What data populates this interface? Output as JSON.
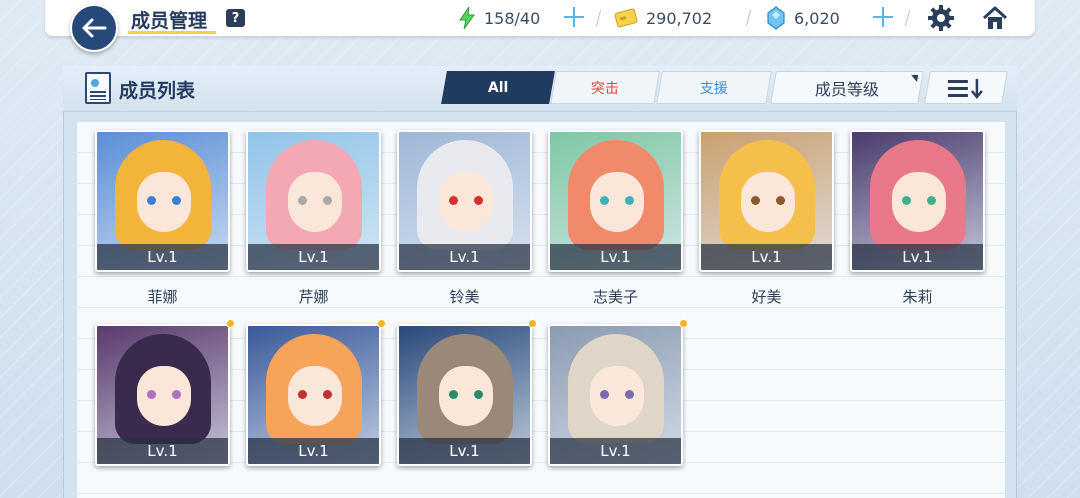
{
  "header": {
    "title": "成员管理",
    "help": "?",
    "ap": "158/40",
    "credits": "290,702",
    "gems": "6,020"
  },
  "panel": {
    "title": "成员列表",
    "tabs": [
      "All",
      "突击",
      "支援"
    ],
    "sort_label": "成员等级"
  },
  "members": [
    {
      "name": "菲娜",
      "level": "Lv.1",
      "new": false,
      "hair": "#f3b43a",
      "bg": "#5a8fd6",
      "eye": "#3a7fd4"
    },
    {
      "name": "芹娜",
      "level": "Lv.1",
      "new": false,
      "hair": "#f3a8b4",
      "bg": "#8fc4e8",
      "eye": "#a9a9a9"
    },
    {
      "name": "铃美",
      "level": "Lv.1",
      "new": false,
      "hair": "#e8eaf0",
      "bg": "#9fb6d6",
      "eye": "#d43030"
    },
    {
      "name": "志美子",
      "level": "Lv.1",
      "new": false,
      "hair": "#f08a6a",
      "bg": "#7ec7a4",
      "eye": "#3fb0b8"
    },
    {
      "name": "好美",
      "level": "Lv.1",
      "new": false,
      "hair": "#f5c04a",
      "bg": "#c9a070",
      "eye": "#8a5a2a"
    },
    {
      "name": "朱莉",
      "level": "Lv.1",
      "new": false,
      "hair": "#e8788a",
      "bg": "#4a3c6e",
      "eye": "#3fb088"
    },
    {
      "name": "",
      "level": "Lv.1",
      "new": true,
      "hair": "#3a2a4e",
      "bg": "#5a3a6e",
      "eye": "#b070c0"
    },
    {
      "name": "",
      "level": "Lv.1",
      "new": true,
      "hair": "#f5a45a",
      "bg": "#3a5a9a",
      "eye": "#c03030"
    },
    {
      "name": "",
      "level": "Lv.1",
      "new": true,
      "hair": "#9a8878",
      "bg": "#2a4a7a",
      "eye": "#2a8a6a"
    },
    {
      "name": "",
      "level": "Lv.1",
      "new": true,
      "hair": "#e0d6c8",
      "bg": "#8a9ab0",
      "eye": "#7a6ab0"
    }
  ]
}
